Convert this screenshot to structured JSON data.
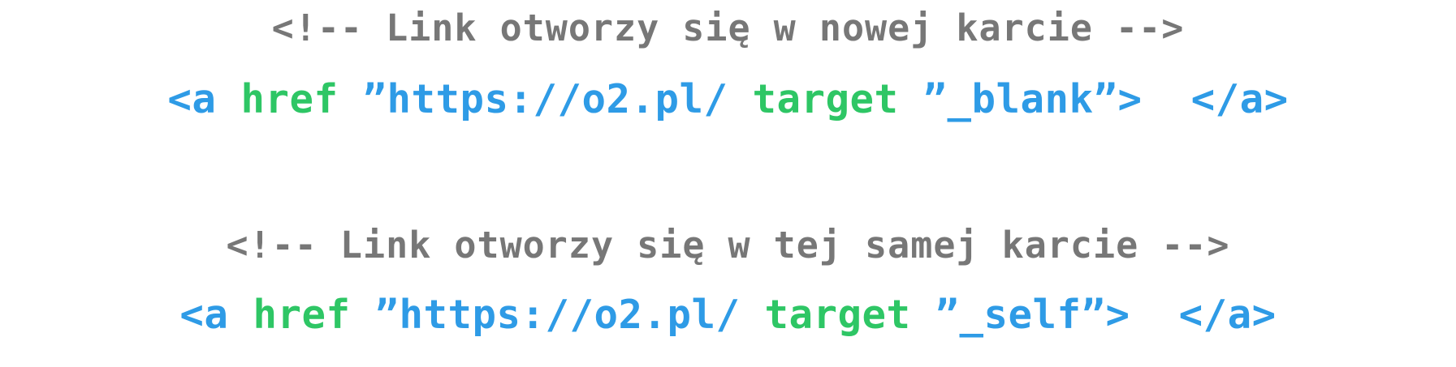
{
  "colors": {
    "comment": "#777777",
    "tag": "#2e9be6",
    "attribute": "#2ec665",
    "value": "#2e9be6",
    "background": "#ffffff"
  },
  "blocks": [
    {
      "comment": "<!-- Link otworzy się w nowej karcie -->",
      "code": {
        "open_tag": "<a",
        "href_attr": "href",
        "href_value": "”https://o2.pl/",
        "target_attr": "target",
        "target_value": "”_blank”>",
        "close_tag": "</a>"
      }
    },
    {
      "comment": "<!-- Link otworzy się w tej samej karcie -->",
      "code": {
        "open_tag": "<a",
        "href_attr": "href",
        "href_value": "”https://o2.pl/",
        "target_attr": "target",
        "target_value": "”_self”>",
        "close_tag": "</a>"
      }
    }
  ]
}
